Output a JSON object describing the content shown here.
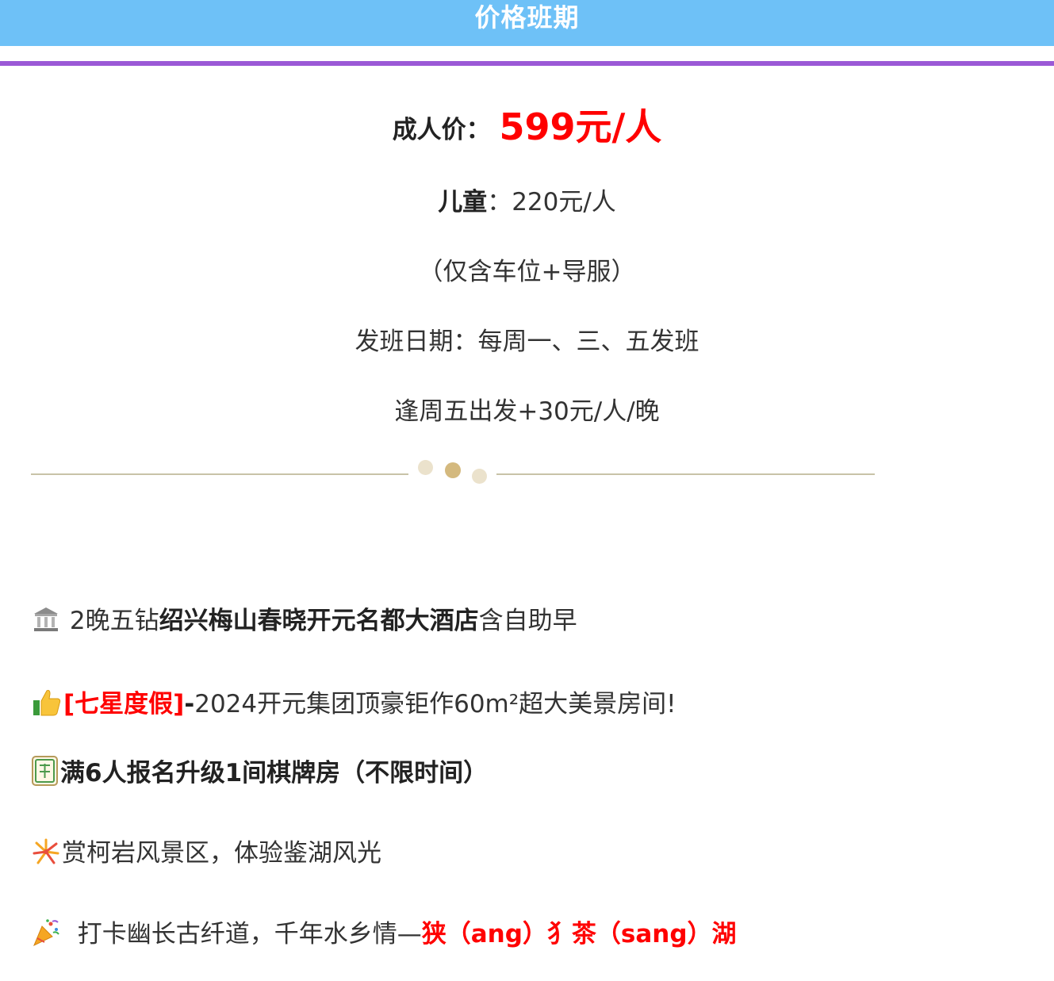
{
  "header": {
    "title": "价格班期"
  },
  "prices": {
    "adult_label": "成人价：",
    "adult_price": "599元/人",
    "child_label": "儿童",
    "child_sep": "：",
    "child_price": "220元/人",
    "note": "（仅含车位+导服）",
    "depart": "发班日期：每周一、三、五发班",
    "friday": "逢周五出发+30元/人/晚"
  },
  "features": {
    "hotel": {
      "icon": "bank-icon",
      "prefix": " 2晚五钻",
      "name": "绍兴梅山春晓开元名都大酒店",
      "suffix": "含自助早"
    },
    "seven_star": {
      "icon": "thumbs-up-icon",
      "tag": "[七星度假]",
      "dash": "-",
      "text": "2024开元集团顶豪钜作60m²超大美景房间!"
    },
    "mahjong": {
      "icon": "mahjong-tile-icon",
      "text": "满6人报名升级1间棋牌房（不限时间）"
    },
    "scenic": {
      "icon": "fireworks-icon",
      "text": "赏柯岩风景区，体验鉴湖风光"
    },
    "trail": {
      "icon": "party-popper-icon",
      "text": "  打卡幽长古纤道，千年水乡情—",
      "highlight": "狭（ang）犭茶（sang）湖"
    }
  },
  "colors": {
    "header_bg": "#6ec1f7",
    "purple_bar": "#9b59d6",
    "price_red": "#ff0000"
  }
}
